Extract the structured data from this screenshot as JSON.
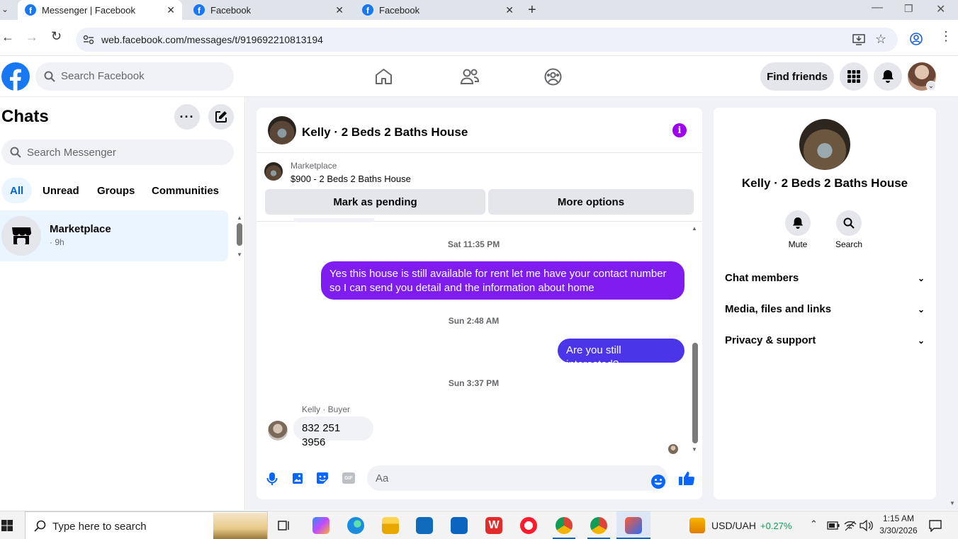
{
  "browser": {
    "tabs": [
      {
        "title": "Messenger | Facebook",
        "active": true
      },
      {
        "title": "Facebook",
        "active": false
      },
      {
        "title": "Facebook",
        "active": false
      }
    ],
    "url": "web.facebook.com/messages/t/919692210813194"
  },
  "fb_header": {
    "search_placeholder": "Search Facebook",
    "find_friends": "Find friends",
    "nav_icons": [
      "home-icon",
      "friends-icon",
      "groups-icon"
    ]
  },
  "sidebar": {
    "title": "Chats",
    "search_placeholder": "Search Messenger",
    "filters": [
      "All",
      "Unread",
      "Groups",
      "Communities"
    ],
    "conversations": [
      {
        "name": "Marketplace",
        "time": "· 9h"
      }
    ]
  },
  "chat": {
    "header_title": "Kelly · 2 Beds 2 Baths House",
    "listing_label": "Marketplace",
    "listing_title": "$900 - 2 Beds 2 Baths House",
    "mark_pending": "Mark as pending",
    "more_options": "More options",
    "timestamps": [
      "Sat 11:35 PM",
      "Sun 2:48 AM",
      "Sun 3:37 PM"
    ],
    "messages": [
      {
        "from": "me",
        "text": "Yes this house is still available for rent let me have your contact number so I can send you detail and the information about home"
      },
      {
        "from": "me",
        "text": "Are you still interested?"
      },
      {
        "from": "them",
        "sender_label": "Kelly · Buyer",
        "text": "832 251 3956"
      }
    ],
    "composer_placeholder": "Aa"
  },
  "details": {
    "title": "Kelly · 2 Beds 2 Baths House",
    "actions": [
      "Mute",
      "Search"
    ],
    "sections": [
      "Chat members",
      "Media, files and links",
      "Privacy & support"
    ]
  },
  "taskbar": {
    "search_placeholder": "Type here to search",
    "currency": "USD/UAH",
    "currency_change": "+0.27%",
    "time": "1:15 AM",
    "date": "3/30/2026"
  },
  "colors": {
    "fb_blue": "#1877f2",
    "bubble_purple": "#7f1df0",
    "bubble_violet": "#4a35e8",
    "accent_purple": "#a000f0"
  }
}
